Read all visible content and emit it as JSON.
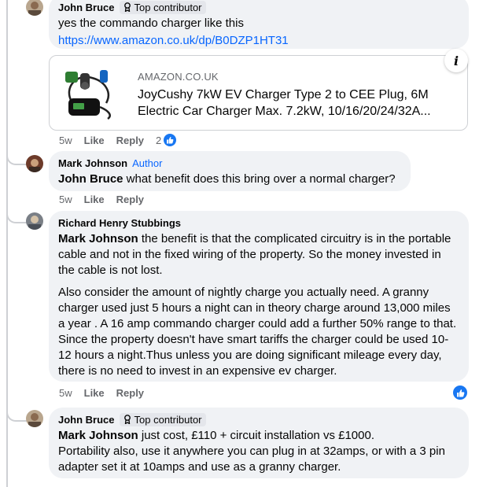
{
  "comments": [
    {
      "author": "John Bruce",
      "badge": "Top contributor",
      "text": "yes the commando charger like this",
      "link": "https://www.amazon.co.uk/dp/B0DZP1HT31",
      "preview": {
        "domain": "AMAZON.CO.UK",
        "title": "JoyCushy 7kW EV Charger Type 2 to CEE Plug, 6M Electric Car Charger Max. 7.2kW, 10/16/20/24/32A..."
      },
      "time": "5w",
      "like_label": "Like",
      "reply_label": "Reply",
      "reactions": "2"
    },
    {
      "author": "Mark Johnson",
      "author_tag": "Author",
      "mention": "John Bruce",
      "text": " what benefit does this bring over a normal charger?",
      "time": "5w",
      "like_label": "Like",
      "reply_label": "Reply"
    },
    {
      "author": "Richard Henry Stubbings",
      "mention": "Mark Johnson",
      "text": " the benefit is that the complicated circuitry is in the portable cable and not in the fixed wiring of the property. So the money invested in the cable is not lost.",
      "text2": "Also consider the amount of nightly charge you actually need. A granny charger used just 5 hours a night can in theory charge around 13,000 miles a year . A 16 amp commando charger could add a further 50% range to that. Since the property doesn't have smart tariffs the charger could be used 10-12 hours a night.Thus unless you are doing significant mileage every day, there is no need to invest in an expensive ev charger.",
      "time": "5w",
      "like_label": "Like",
      "reply_label": "Reply"
    },
    {
      "author": "John Bruce",
      "badge": "Top contributor",
      "mention": "Mark Johnson",
      "text": " just cost, £110 + circuit installation vs £1000.",
      "text2": "Portability also, use it anywhere you can plug in at 32amps, or with a 3 pin adapter set it at 10amps and use as a granny charger."
    }
  ],
  "colors": {
    "link": "#0866ff",
    "bubble": "#f0f2f5",
    "meta": "#65676b",
    "like": "#1877f2"
  },
  "icons": [
    "badge-icon",
    "info-icon",
    "like-thumb-icon",
    "charger-product-image"
  ]
}
